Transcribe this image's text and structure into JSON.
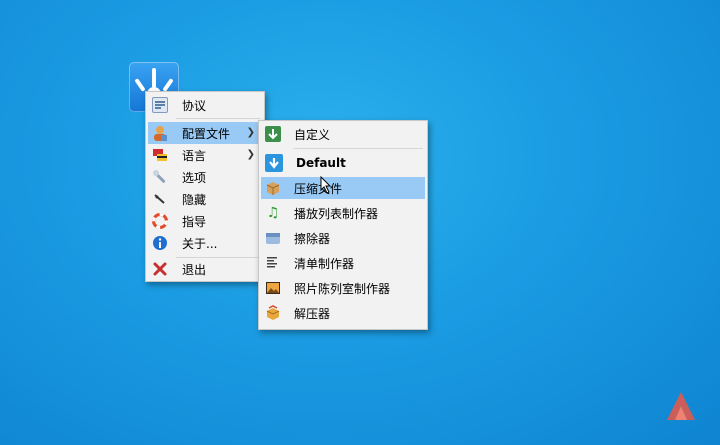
{
  "main_menu": {
    "items": [
      {
        "label": "协议",
        "icon": "protocol-icon",
        "color": "#5b7fa8"
      },
      {
        "label": "配置文件",
        "icon": "profile-icon",
        "color": "#e37b1f"
      },
      {
        "label": "语言",
        "icon": "language-flag-icon",
        "color": "#d22b2b"
      },
      {
        "label": "选项",
        "icon": "wrench-icon",
        "color": "#6a7b8c"
      },
      {
        "label": "隐藏",
        "icon": "hide-icon",
        "color": "#555555"
      },
      {
        "label": "指导",
        "icon": "lifebuoy-icon",
        "color": "#e24a2b"
      },
      {
        "label": "关于...",
        "icon": "info-icon",
        "color": "#1f6fd0"
      },
      {
        "label": "退出",
        "icon": "exit-icon",
        "color": "#c62f2f"
      }
    ]
  },
  "sub_menu": {
    "items": [
      {
        "label": "自定义",
        "icon": "custom-icon",
        "color": "#3b8f4b"
      },
      {
        "label": "Default",
        "icon": "default-download-icon",
        "color": "#2b95de"
      },
      {
        "label": "压缩文件",
        "icon": "compress-box-icon",
        "color": "#c98a3b"
      },
      {
        "label": "播放列表制作器",
        "icon": "playlist-note-icon",
        "color": "#2e9a2e"
      },
      {
        "label": "擦除器",
        "icon": "eraser-icon",
        "color": "#7aa6d6"
      },
      {
        "label": "清单制作器",
        "icon": "list-icon",
        "color": "#444444"
      },
      {
        "label": "照片陈列室制作器",
        "icon": "photo-gallery-icon",
        "color": "#c76a1d"
      },
      {
        "label": "解压器",
        "icon": "extract-box-icon",
        "color": "#e0a23a"
      }
    ]
  },
  "colors": {
    "desktop": "#1a9be2",
    "selection": "#99c9f5"
  }
}
